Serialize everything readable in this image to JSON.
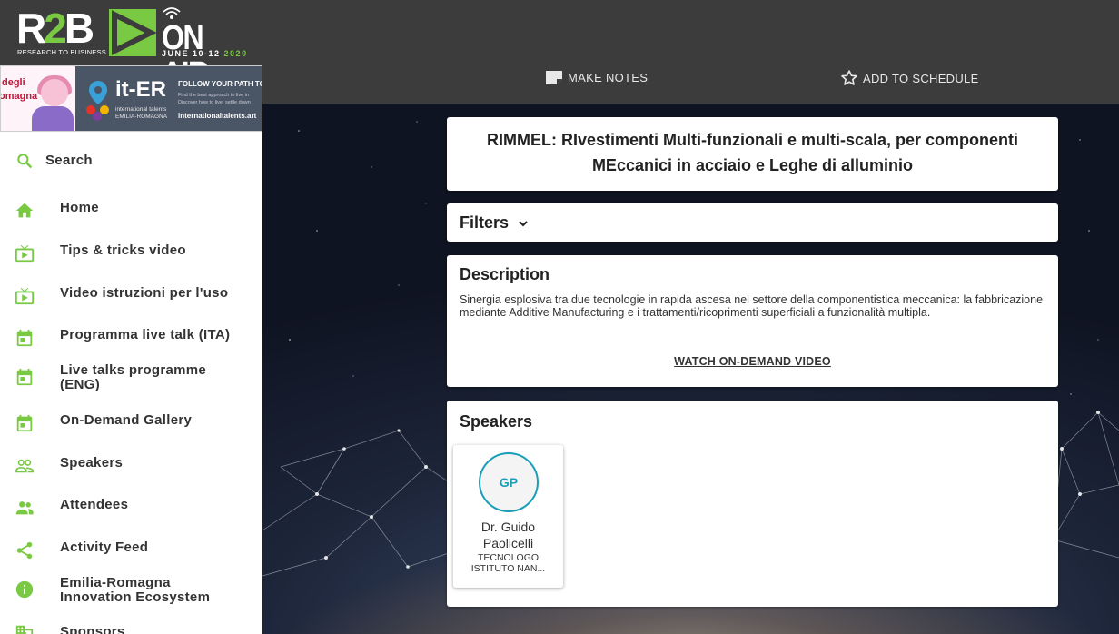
{
  "brand": {
    "logo_main": "R2B",
    "logo_sub": "RESEARCH TO BUSINESS",
    "logo_onair": "ON AIR",
    "logo_dates": "JUNE 10-12",
    "logo_year": "2020",
    "accent_color": "#7ac943"
  },
  "header": {
    "make_notes_label": "MAKE NOTES",
    "add_schedule_label": "ADD TO SCHEDULE"
  },
  "banner": {
    "left_text_1": "degli",
    "left_text_2": "omagna",
    "iter_title": "it-ER",
    "iter_sub_1": "international talents",
    "iter_sub_2": "EMILIA-ROMAGNA",
    "follow": "FOLLOW YOUR PATH TO I",
    "small_1": "Find the best approach to live in",
    "small_2": "Discover how to live, settle down",
    "url": "internationaltalents.art"
  },
  "sidebar": {
    "search_label": "Search",
    "items": [
      {
        "label": "Home",
        "icon": "home-icon"
      },
      {
        "label": "Tips & tricks video",
        "icon": "tv-icon"
      },
      {
        "label": "Video istruzioni per l'uso",
        "icon": "tv-icon"
      },
      {
        "label": "Programma live talk (ITA)",
        "icon": "calendar-icon"
      },
      {
        "label": "Live talks programme (ENG)",
        "icon": "calendar-icon"
      },
      {
        "label": "On-Demand Gallery",
        "icon": "calendar-icon"
      },
      {
        "label": "Speakers",
        "icon": "people-outline-icon"
      },
      {
        "label": "Attendees",
        "icon": "people-icon"
      },
      {
        "label": "Activity Feed",
        "icon": "share-icon"
      },
      {
        "label": "Emilia-Romagna Innovation Ecosystem",
        "icon": "info-icon"
      },
      {
        "label": "Sponsors",
        "icon": "business-icon"
      }
    ],
    "icon_color": "#7ac943"
  },
  "session": {
    "title": "RIMMEL: RIvestimenti Multi-funzionali e multi-scala, per componenti MEccanici in acciaio e Leghe di alluminio",
    "filters_label": "Filters",
    "description_heading": "Description",
    "description_text": "Sinergia esplosiva tra due tecnologie in rapida ascesa nel settore della componentistica meccanica: la fabbricazione mediante Additive Manufacturing e i trattamenti/ricoprimenti superficiali a funzionalità multipla.",
    "watch_link": "WATCH ON-DEMAND VIDEO",
    "speakers_heading": "Speakers",
    "speakers": [
      {
        "initials": "GP",
        "name": "Dr. Guido Paolicelli",
        "role": "TECNOLOGO ISTITUTO NAN..."
      }
    ]
  }
}
